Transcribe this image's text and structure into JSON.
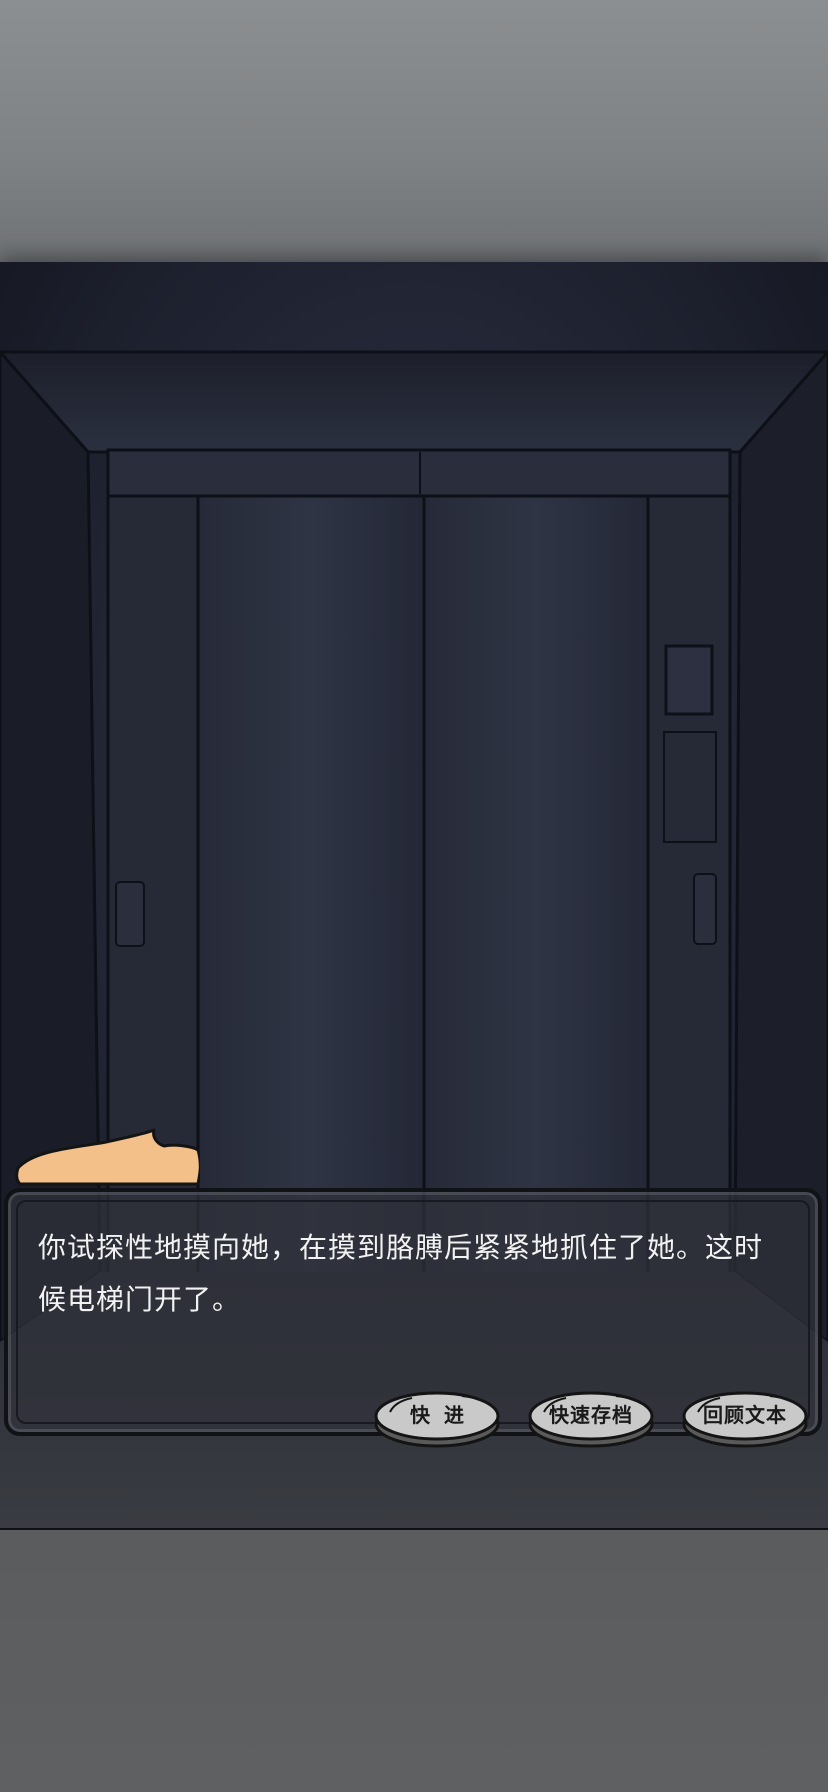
{
  "dialogue": {
    "text": "你试探性地摸向她，在摸到胳膊后紧紧地抓住了她。这时候电梯门开了。"
  },
  "buttons": {
    "fast_forward": "快进",
    "quick_save": "快速存档",
    "review_text": "回顾文本"
  },
  "colors": {
    "speaker_tab": "#f2c088",
    "dialogue_text": "#f2f2f2",
    "button_fill": "#c9c9c9"
  }
}
